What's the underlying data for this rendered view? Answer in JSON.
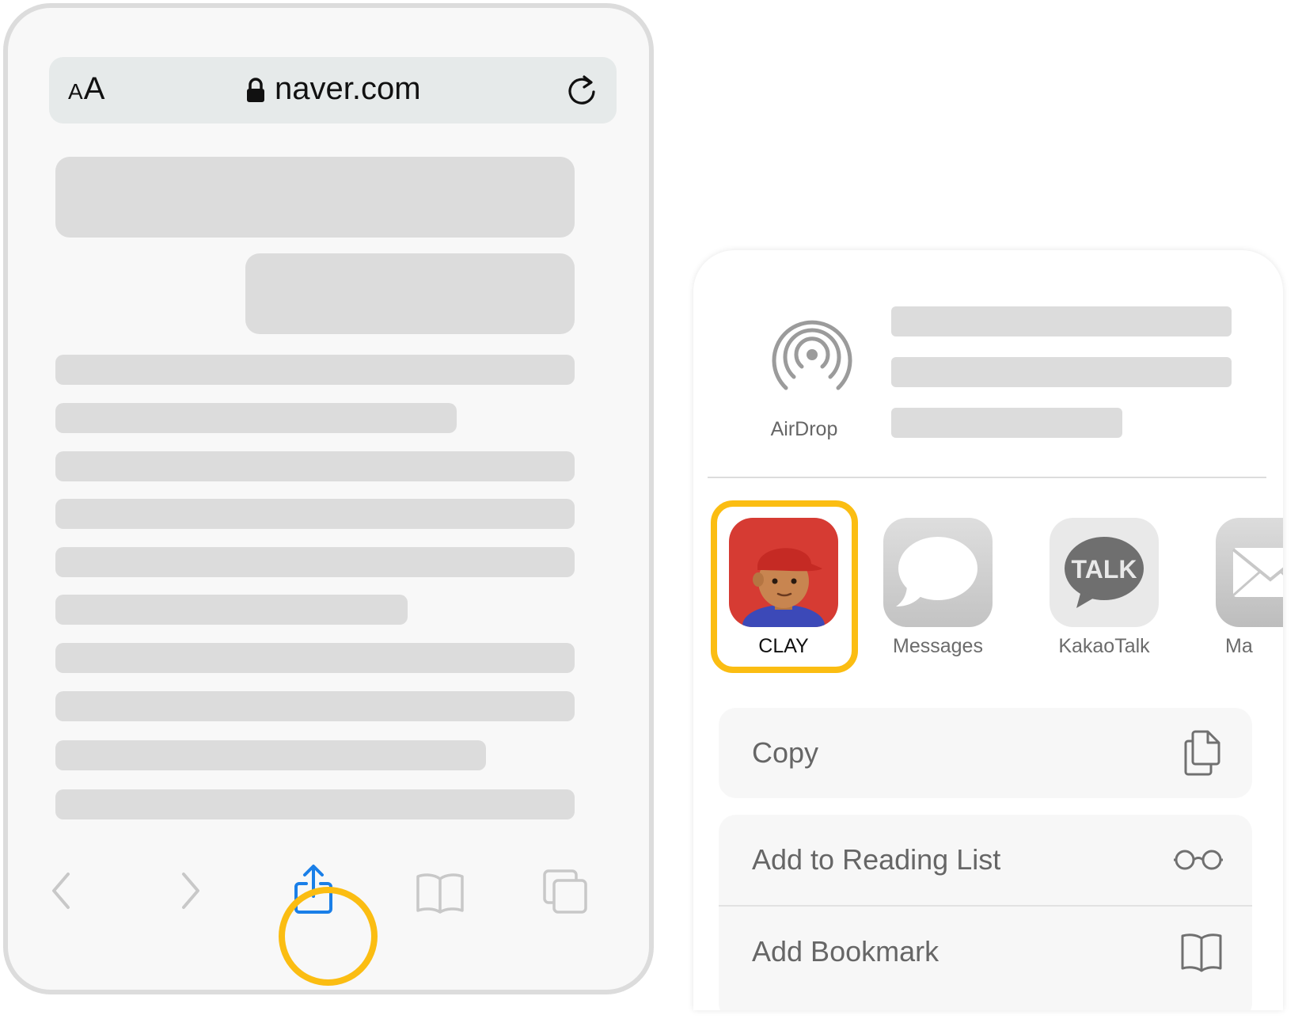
{
  "browser": {
    "text_size_button": {
      "small": "A",
      "large": "A"
    },
    "domain": "naver.com",
    "icons": {
      "lock": "lock-icon",
      "reload": "reload-icon"
    }
  },
  "toolbar": {
    "icons": [
      "back-chevron-icon",
      "forward-chevron-icon",
      "share-icon",
      "bookmarks-book-icon",
      "tabs-icon"
    ],
    "highlight_color": "#fbbd12",
    "share_color": "#1a7fe8"
  },
  "share_sheet": {
    "airdrop": {
      "label": "AirDrop",
      "icon": "airdrop-icon"
    },
    "apps": [
      {
        "label": "CLAY",
        "icon": "clay-app-icon"
      },
      {
        "label": "Messages",
        "icon": "messages-icon"
      },
      {
        "label": "KakaoTalk",
        "icon": "kakaotalk-icon",
        "badge": "TALK"
      },
      {
        "label": "Ma",
        "icon": "mail-icon"
      }
    ],
    "actions": [
      {
        "label": "Copy",
        "icon": "copy-icon"
      },
      {
        "label": "Add to Reading List",
        "icon": "glasses-icon"
      },
      {
        "label": "Add Bookmark",
        "icon": "book-icon"
      }
    ]
  }
}
